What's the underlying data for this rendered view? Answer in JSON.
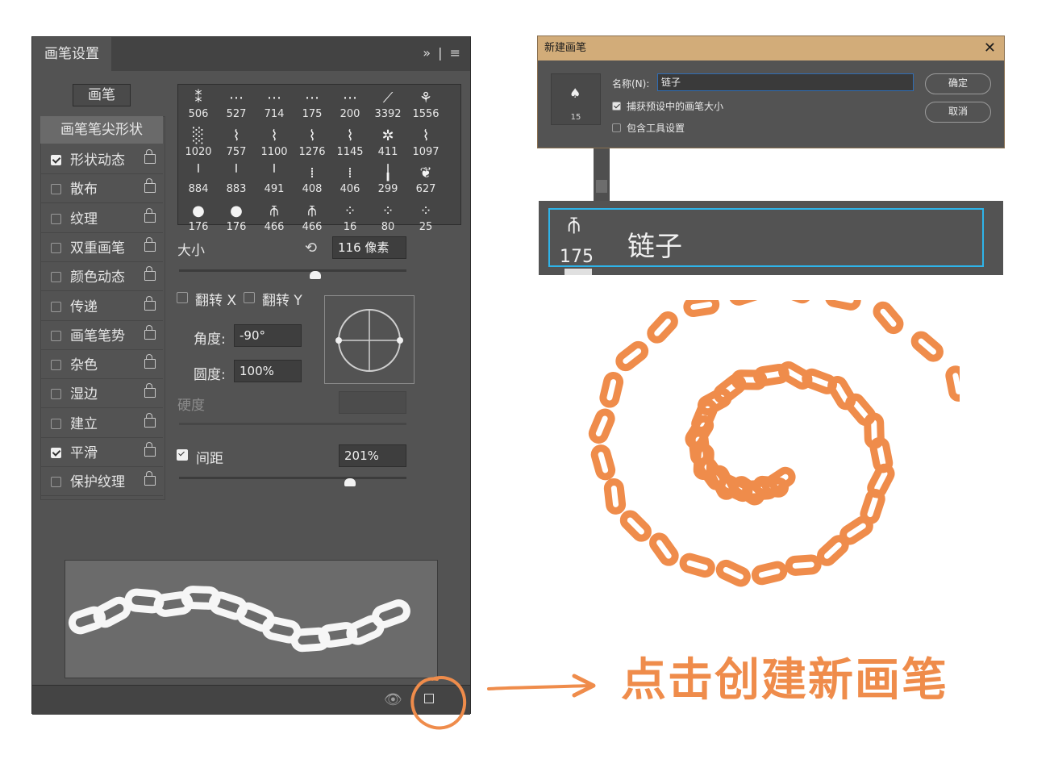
{
  "panel": {
    "tab_label": "画笔设置",
    "menu_glyphs": "»  |  ≡",
    "brushes_button": "画笔",
    "tip_shape_label": "画笔笔尖形状",
    "options": [
      {
        "label": "形状动态",
        "checked": true
      },
      {
        "label": "散布",
        "checked": false
      },
      {
        "label": "纹理",
        "checked": false
      },
      {
        "label": "双重画笔",
        "checked": false
      },
      {
        "label": "颜色动态",
        "checked": false
      },
      {
        "label": "传递",
        "checked": false
      },
      {
        "label": "画笔笔势",
        "checked": false
      },
      {
        "label": "杂色",
        "checked": false
      },
      {
        "label": "湿边",
        "checked": false
      },
      {
        "label": "建立",
        "checked": false
      },
      {
        "label": "平滑",
        "checked": true
      },
      {
        "label": "保护纹理",
        "checked": false
      }
    ],
    "brush_grid": [
      [
        "506",
        "527",
        "714",
        "175",
        "200",
        "3392",
        "1556"
      ],
      [
        "1020",
        "757",
        "1100",
        "1276",
        "1145",
        "411",
        "1097"
      ],
      [
        "884",
        "883",
        "491",
        "408",
        "406",
        "299",
        "627"
      ],
      [
        "176",
        "176",
        "466",
        "466",
        "16",
        "80",
        "25"
      ]
    ],
    "size_label": "大小",
    "size_value": "116 像素",
    "size_fraction": 0.6,
    "flip_x_label": "翻转 X",
    "flip_y_label": "翻转 Y",
    "angle_label": "角度:",
    "angle_value": "-90°",
    "roundness_label": "圆度:",
    "roundness_value": "100%",
    "hardness_label": "硬度",
    "spacing_label": "间距",
    "spacing_checked": true,
    "spacing_value": "201%",
    "spacing_fraction": 0.75
  },
  "dialog": {
    "title": "新建画笔",
    "close_glyph": "✕",
    "thumb_size": "15",
    "name_label": "名称(N):",
    "name_value": "链子",
    "capture_size_label": "捕获预设中的画笔大小",
    "capture_size_checked": true,
    "include_tool_label": "包含工具设置",
    "include_tool_checked": false,
    "ok_label": "确定",
    "cancel_label": "取消"
  },
  "zoom_item": {
    "size": "175",
    "name": "链子"
  },
  "caption": "点击创建新画笔",
  "colors": {
    "accent_orange": "#ef8c4b",
    "panel_bg": "#535353",
    "dialog_title_bg": "#d2ac79",
    "selection_blue": "#2eb4ea"
  }
}
